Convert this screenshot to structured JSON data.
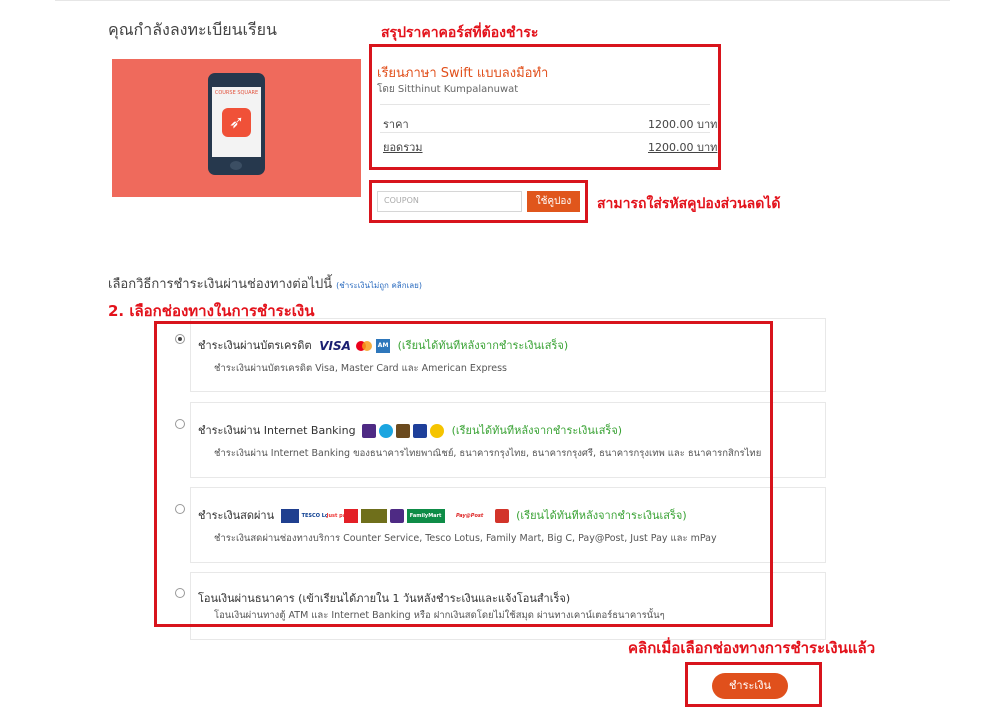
{
  "header": {
    "enroll_title": "คุณกำลังลงทะเบียนเรียน"
  },
  "course_image": {
    "brand": "COURSE SQUARE",
    "icon": "swift-logo-icon"
  },
  "annotations": {
    "summary": "สรุปราคาคอร์สที่ต้องชำระ",
    "coupon": "สามารถใส่รหัสคูปองส่วนลดได้",
    "channel": "2. เลือกช่องทางในการชำระเงิน",
    "click_pay": "คลิกเมื่อเลือกช่องทางการชำระเงินแล้ว",
    "color": "#e3121b"
  },
  "summary": {
    "course_title": "เรียนภาษา Swift แบบลงมือทำ",
    "instructor": "โดย Sitthinut Kumpalanuwat",
    "price_label": "ราคา",
    "price_value": "1200.00 บาท",
    "total_label": "ยอดรวม",
    "total_value": "1200.00 บาท"
  },
  "coupon": {
    "placeholder": "COUPON",
    "button_label": "ใช้คูปอง"
  },
  "payment": {
    "title": "เลือกวิธีการชำระเงินผ่านช่องทางต่อไปนี้",
    "help_link": "(ชำระเงินไม่ถูก คลิกเลย)",
    "methods": [
      {
        "name": "ชำระเงินผ่านบัตรเครดิต",
        "note": "(เรียนได้ทันทีหลังจากชำระเงินเสร็จ)",
        "description": "ชำระเงินผ่านบัตรเครดิต Visa, Master Card และ American Express",
        "selected": true,
        "logos": [
          "VISA"
        ]
      },
      {
        "name": "ชำระเงินผ่าน Internet Banking",
        "note": "(เรียนได้ทันทีหลังจากชำระเงินเสร็จ)",
        "description": "ชำระเงินผ่าน Internet Banking ของธนาคารไทยพาณิชย์, ธนาคารกรุงไทย, ธนาคารกรุงศรี, ธนาคารกรุงเทพ และ ธนาคารกสิกรไทย",
        "selected": false
      },
      {
        "name": "ชำระเงินสดผ่าน",
        "note": "(เรียนได้ทันทีหลังจากชำระเงินเสร็จ)",
        "description": "ชำระเงินสดผ่านช่องทางบริการ Counter Service, Tesco Lotus, Family Mart, Big C, Pay@Post, Just Pay และ mPay",
        "selected": false,
        "logos": [
          "TESCO Lotus",
          "Just pay",
          "FamilyMart",
          "Pay@Post"
        ]
      },
      {
        "name": "โอนเงินผ่านธนาคาร (เข้าเรียนได้ภายใน 1 วันหลังชำระเงินและแจ้งโอนสำเร็จ)",
        "note": "",
        "description": "โอนเงินผ่านทางตู้ ATM และ Internet Banking หรือ ฝากเงินสดโดยไม่ใช้สมุด ผ่านทางเคาน์เตอร์ธนาคารนั้นๆ",
        "selected": false
      }
    ]
  },
  "pay_button": {
    "label": "ชำระเงิน",
    "color": "#e0501c"
  },
  "colors": {
    "accent": "#e0561c",
    "annotation_box": "#d8141c",
    "note_green": "#3aa335"
  }
}
